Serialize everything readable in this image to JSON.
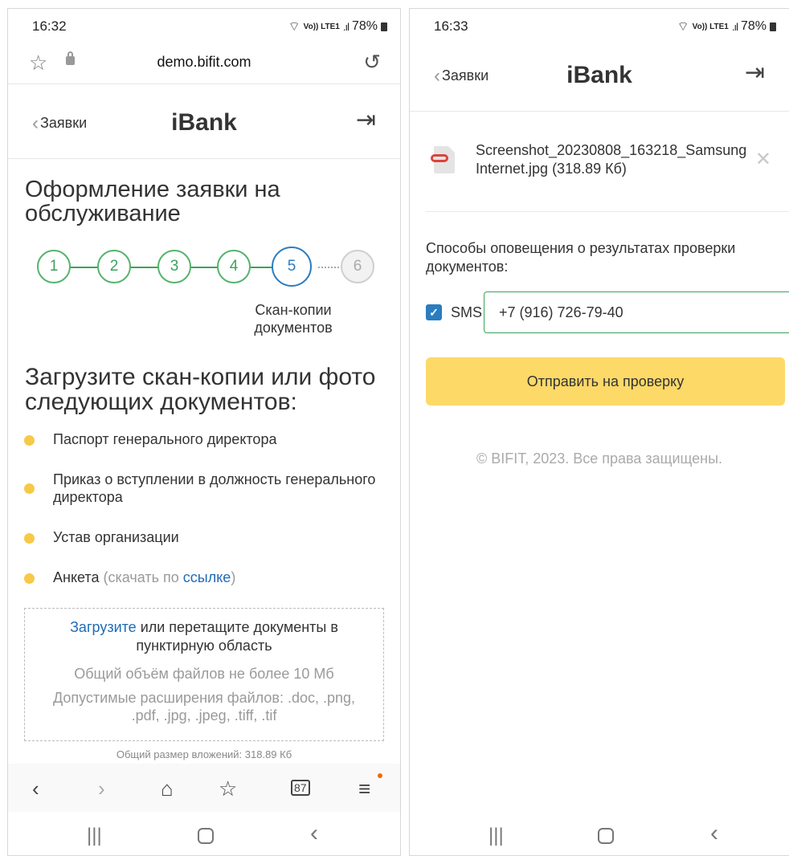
{
  "left": {
    "status": {
      "time": "16:32",
      "network": "Vo)) LTE1",
      "battery": "78%"
    },
    "url": "demo.bifit.com",
    "header": {
      "back": "Заявки",
      "brand": "iBank"
    },
    "title": "Оформление заявки на обслуживание",
    "steps": [
      "1",
      "2",
      "3",
      "4",
      "5",
      "6"
    ],
    "current_step": 5,
    "step_caption": "Скан-копии документов",
    "upload_title": "Загрузите скан-копии или фото следующих документов:",
    "documents": {
      "passport": "Паспорт генерального директора",
      "order": "Приказ о вступлении в должность генерального директора",
      "charter": "Устав организации",
      "form": "Анкета",
      "form_hint_pre": "(скачать по ",
      "form_link": "ссылке",
      "form_hint_post": ")"
    },
    "dropzone": {
      "link": "Загрузите",
      "text": " или перетащите документы в пунктирную область",
      "limit": "Общий объём файлов не более 10 Мб",
      "extensions": "Допустимые расширения файлов: .doc, .png, .pdf, .jpg, .jpeg, .tiff, .tif"
    },
    "attachments_total": "Общий размер вложений: 318.89 Кб",
    "tabs_count": "87"
  },
  "right": {
    "status": {
      "time": "16:33",
      "network": "Vo)) LTE1",
      "battery": "78%"
    },
    "header": {
      "back": "Заявки",
      "brand": "iBank"
    },
    "file_name": "Screenshot_20230808_163218_Samsung Internet.jpg (318.89 Кб)",
    "notify_label": "Способы оповещения о результатах проверки документов:",
    "sms_label": "SMS",
    "phone": "+7 (916) 726-79-40",
    "submit": "Отправить на проверку",
    "copyright": "© BIFIT, 2023. Все права защищены."
  },
  "colors": {
    "accent_green": "#3aa35c",
    "active_blue": "#2a7dc0",
    "bullet_yellow": "#f7c948",
    "button_yellow": "#fdd968",
    "link_blue": "#1e6bb8"
  }
}
